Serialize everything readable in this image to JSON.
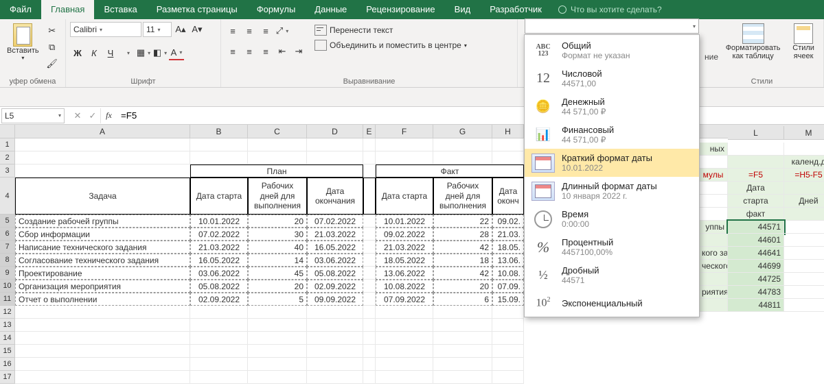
{
  "menu": {
    "tabs": [
      "Файл",
      "Главная",
      "Вставка",
      "Разметка страницы",
      "Формулы",
      "Данные",
      "Рецензирование",
      "Вид",
      "Разработчик"
    ],
    "active": "Главная",
    "tell_me": "Что вы хотите сделать?"
  },
  "ribbon": {
    "clipboard": {
      "paste": "Вставить",
      "label": "уфер обмена"
    },
    "font": {
      "name": "Calibri",
      "size": "11",
      "bold": "Ж",
      "italic": "К",
      "underline": "Ч",
      "label": "Шрифт"
    },
    "alignment": {
      "wrap": "Перенести текст",
      "merge": "Объединить и поместить в центре",
      "label": "Выравнивание"
    },
    "styles": {
      "format_table": "Форматировать как таблицу",
      "cell_styles": "Стили ячеек",
      "label": "Стили",
      "nie": "ние"
    }
  },
  "formula": {
    "name_box": "L5",
    "expr": "=F5"
  },
  "dropdown": {
    "items": [
      {
        "icon": "ABC123",
        "title": "Общий",
        "sub": "Формат не указан"
      },
      {
        "icon": "12",
        "title": "Числовой",
        "sub": "44571,00"
      },
      {
        "icon": "coins",
        "title": "Денежный",
        "sub": "44 571,00 ₽"
      },
      {
        "icon": "ledger",
        "title": "Финансовый",
        "sub": "44 571,00 ₽"
      },
      {
        "icon": "cal",
        "title": "Краткий формат даты",
        "sub": "10.01.2022",
        "selected": true
      },
      {
        "icon": "cal",
        "title": "Длинный формат даты",
        "sub": "10 января 2022 г."
      },
      {
        "icon": "clock",
        "title": "Время",
        "sub": "0:00:00"
      },
      {
        "icon": "%",
        "title": "Процентный",
        "sub": "4457100,00%"
      },
      {
        "icon": "1/2",
        "title": "Дробный",
        "sub": "44571"
      },
      {
        "icon": "10^2",
        "title": "Экспоненциальный",
        "sub": ""
      }
    ]
  },
  "columns": [
    "A",
    "B",
    "C",
    "D",
    "E",
    "F",
    "G",
    "H"
  ],
  "columns_right": [
    "L",
    "M"
  ],
  "headers1": {
    "plan": "План",
    "fact": "Факт"
  },
  "headers2": {
    "task": "Задача",
    "start": "Дата старта",
    "work": "Рабочих дней для выполнения",
    "end": "Дата окончания",
    "start2": "Дата старта",
    "work2": "Рабочих дней для выполнения",
    "end2": "Дата оконч"
  },
  "rows": [
    {
      "n": 5,
      "task": "Создание рабочей группы",
      "ps": "10.01.2022",
      "pw": "20",
      "pe": "07.02.2022",
      "fs": "10.01.2022",
      "fw": "22",
      "fe": "09.02."
    },
    {
      "n": 6,
      "task": "Сбор информации",
      "ps": "07.02.2022",
      "pw": "30",
      "pe": "21.03.2022",
      "fs": "09.02.2022",
      "fw": "28",
      "fe": "21.03."
    },
    {
      "n": 7,
      "task": "Написание технического задания",
      "ps": "21.03.2022",
      "pw": "40",
      "pe": "16.05.2022",
      "fs": "21.03.2022",
      "fw": "42",
      "fe": "18.05."
    },
    {
      "n": 8,
      "task": "Согласование технического задания",
      "ps": "16.05.2022",
      "pw": "14",
      "pe": "03.06.2022",
      "fs": "18.05.2022",
      "fw": "18",
      "fe": "13.06."
    },
    {
      "n": 9,
      "task": "Проектирование",
      "ps": "03.06.2022",
      "pw": "45",
      "pe": "05.08.2022",
      "fs": "13.06.2022",
      "fw": "42",
      "fe": "10.08."
    },
    {
      "n": 10,
      "task": "Организация мероприятия",
      "ps": "05.08.2022",
      "pw": "20",
      "pe": "02.09.2022",
      "fs": "10.08.2022",
      "fw": "20",
      "fe": "07.09."
    },
    {
      "n": 11,
      "task": "Отчет о выполнении",
      "ps": "02.09.2022",
      "pw": "5",
      "pe": "09.09.2022",
      "fs": "07.09.2022",
      "fw": "6",
      "fe": "15.09."
    }
  ],
  "right_peek": {
    "top_text": "ных",
    "kalend": "календ.д",
    "muly": "мулы",
    "f5": "=F5",
    "h5f5": "=H5-F5",
    "l_hdr1": "Дата",
    "l_hdr2": "старта",
    "l_hdr3": "факт",
    "m_hdr": "Дней",
    "labels": [
      "уппы",
      "кого за",
      "ческого",
      "риятия"
    ],
    "vals": [
      "44571",
      "44601",
      "44641",
      "44699",
      "44725",
      "44783",
      "44811"
    ]
  }
}
